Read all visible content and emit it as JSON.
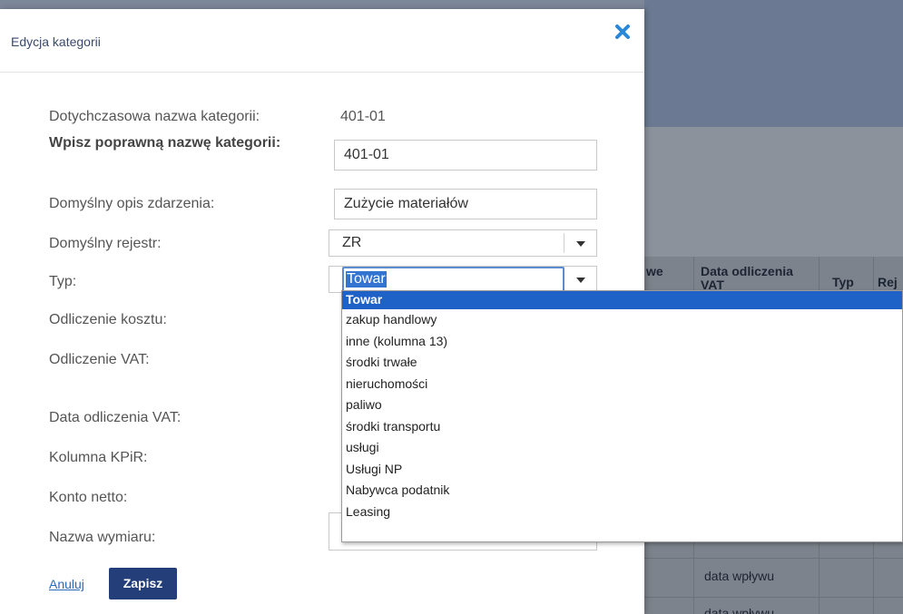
{
  "modal": {
    "title": "Edycja kategorii",
    "fields": [
      {
        "label": "Dotychczasowa nazwa kategorii:",
        "value": "401-01"
      },
      {
        "label": "Wpisz poprawną nazwę kategorii:",
        "value": "401-01"
      },
      {
        "label": "Domyślny opis zdarzenia:",
        "value": "Zużycie materiałów"
      },
      {
        "label": "Domyślny rejestr:",
        "value": "ZR"
      },
      {
        "label": "Typ:",
        "value": "Towar"
      },
      {
        "label": "Odliczenie kosztu:"
      },
      {
        "label": "Odliczenie VAT:"
      },
      {
        "label": "Data odliczenia VAT:"
      },
      {
        "label": "Kolumna KPiR:"
      },
      {
        "label": "Konto netto:"
      },
      {
        "label": "Nazwa wymiaru:"
      }
    ],
    "cancel_label": "Anuluj",
    "save_label": "Zapisz"
  },
  "dropdown_options": [
    "Towar",
    "zakup handlowy",
    "inne (kolumna 13)",
    "środki trwałe",
    "nieruchomości",
    "paliwo",
    "środki transportu",
    "usługi",
    "Usługi NP",
    "Nabywca podatnik",
    "Leasing"
  ],
  "background_table": {
    "headers": [
      "we",
      "Data odliczenia VAT",
      "Typ",
      "Rej"
    ],
    "cells": [
      "data wpływu",
      "data wpływu"
    ]
  },
  "colors": {
    "accent": "#243e7a",
    "selection": "#1e62c8",
    "close_icon": "#2b88d8"
  }
}
